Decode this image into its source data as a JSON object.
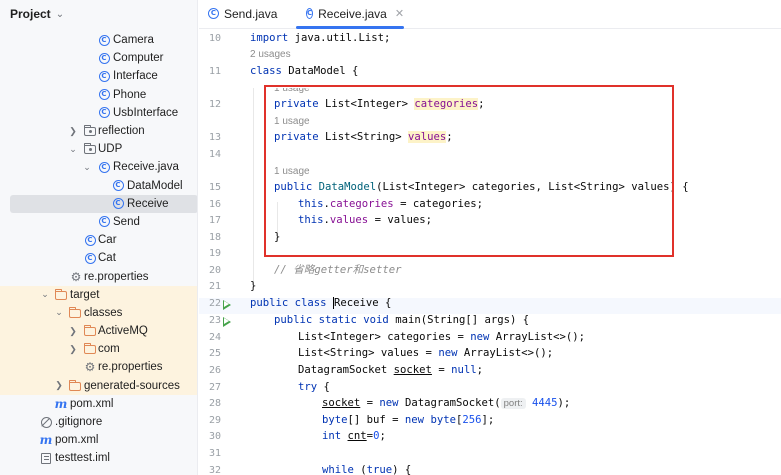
{
  "project_panel": {
    "title": "Project",
    "tree": [
      {
        "label": "Camera",
        "icon": "class-icon",
        "name": "tree-item-camera"
      },
      {
        "label": "Computer",
        "icon": "class-icon",
        "name": "tree-item-computer"
      },
      {
        "label": "Interface",
        "icon": "class-icon",
        "name": "tree-item-interface"
      },
      {
        "label": "Phone",
        "icon": "class-icon",
        "name": "tree-item-phone"
      },
      {
        "label": "UsbInterface",
        "icon": "class-icon",
        "name": "tree-item-usbinterface"
      },
      {
        "label": "reflection",
        "icon": "package-icon",
        "name": "tree-item-reflection"
      },
      {
        "label": "UDP",
        "icon": "package-icon",
        "name": "tree-item-udp"
      },
      {
        "label": "Receive.java",
        "icon": "class-icon",
        "name": "tree-item-receive-java"
      },
      {
        "label": "DataModel",
        "icon": "class-icon",
        "name": "tree-item-datamodel"
      },
      {
        "label": "Receive",
        "icon": "class-icon",
        "name": "tree-item-receive"
      },
      {
        "label": "Send",
        "icon": "class-icon",
        "name": "tree-item-send"
      },
      {
        "label": "Car",
        "icon": "class-icon",
        "name": "tree-item-car"
      },
      {
        "label": "Cat",
        "icon": "class-icon",
        "name": "tree-item-cat"
      },
      {
        "label": "re.properties",
        "icon": "properties-icon",
        "name": "tree-item-re-properties"
      },
      {
        "label": "target",
        "icon": "folder-icon",
        "name": "tree-item-target"
      },
      {
        "label": "classes",
        "icon": "folder-icon",
        "name": "tree-item-classes"
      },
      {
        "label": "ActiveMQ",
        "icon": "folder-icon",
        "name": "tree-item-activemq"
      },
      {
        "label": "com",
        "icon": "folder-icon",
        "name": "tree-item-com"
      },
      {
        "label": "re.properties",
        "icon": "properties-icon",
        "name": "tree-item-re-properties-target"
      },
      {
        "label": "generated-sources",
        "icon": "folder-icon",
        "name": "tree-item-generated-sources"
      },
      {
        "label": "pom.xml",
        "icon": "maven-icon",
        "name": "tree-item-pom-inner"
      },
      {
        "label": ".gitignore",
        "icon": "gitignore-icon",
        "name": "tree-item-gitignore"
      },
      {
        "label": "pom.xml",
        "icon": "maven-icon",
        "name": "tree-item-pom"
      },
      {
        "label": "testtest.iml",
        "icon": "iml-icon",
        "name": "tree-item-testtest-iml"
      }
    ]
  },
  "tabs": [
    {
      "label": "Send.java",
      "active": false
    },
    {
      "label": "Receive.java",
      "active": true
    }
  ],
  "hints": {
    "two_usages": "2 usages",
    "one_usage": "1 usage",
    "port_param": "port:"
  },
  "code": {
    "line_numbers": [
      "10",
      "11",
      "12",
      "13",
      "14",
      "15",
      "16",
      "17",
      "18",
      "19",
      "20",
      "21",
      "22",
      "23",
      "24",
      "25",
      "26",
      "27",
      "28",
      "29",
      "30",
      "31",
      "32"
    ],
    "l10": {
      "kw": "import",
      "rest": " java.util.List;"
    },
    "l11": {
      "kw": "class",
      "rest": " DataModel {"
    },
    "l12": {
      "kw": "private",
      "type": " List<Integer> ",
      "field": "categories",
      "end": ";"
    },
    "l13": {
      "kw": "private",
      "type": " List<String> ",
      "field": "values",
      "end": ";"
    },
    "l15": {
      "kw": "public",
      "ctor": "DataModel",
      "rest": "(List<Integer> categories, List<String> values) {"
    },
    "l16": {
      "kw": "this",
      "dot": ".",
      "field": "categories",
      "rest": " = categories;"
    },
    "l17": {
      "kw": "this",
      "dot": ".",
      "field": "values",
      "rest": " = values;"
    },
    "l18": "}",
    "l20": "// 省略getter和setter",
    "l21": "}",
    "l22": {
      "kw": "public class",
      "pre": " ",
      "name": "Receive",
      "rest": " {"
    },
    "l23": {
      "kw": "public static void",
      "rest": " main(String[] args) {"
    },
    "l24": {
      "pre": "List<Integer> categories = ",
      "kw": "new",
      "rest": " ArrayList<>();"
    },
    "l25": {
      "pre": "List<String> values = ",
      "kw": "new",
      "rest": " ArrayList<>();"
    },
    "l26": {
      "pre": "DatagramSocket ",
      "var": "socket",
      "mid": " = ",
      "kw": "null",
      "rest": ";"
    },
    "l27": {
      "kw": "try",
      "rest": " {"
    },
    "l28": {
      "var": "socket",
      "mid": " = ",
      "kw": "new",
      "rest": " DatagramSocket(",
      "num": "4445",
      "end": ");"
    },
    "l29": {
      "kw": "byte",
      "pre": "[] buf = ",
      "kw2": "new",
      "kw3": " byte",
      "rest": "[",
      "num": "256",
      "end": "];"
    },
    "l30": {
      "kw": "int",
      "var": "cnt",
      "mid": "=",
      "num": "0",
      "end": ";"
    },
    "l32": {
      "kw": "while",
      "rest": " (",
      "kw2": "true",
      "end": ") {"
    }
  },
  "colors": {
    "keyword": "#0033b3",
    "field": "#871094",
    "number": "#1750eb",
    "comment": "#8c8c8c",
    "annotation_box": "#e0312a",
    "selection": "#dfe1e5",
    "excluded_folder_bg": "#fdf3df"
  }
}
